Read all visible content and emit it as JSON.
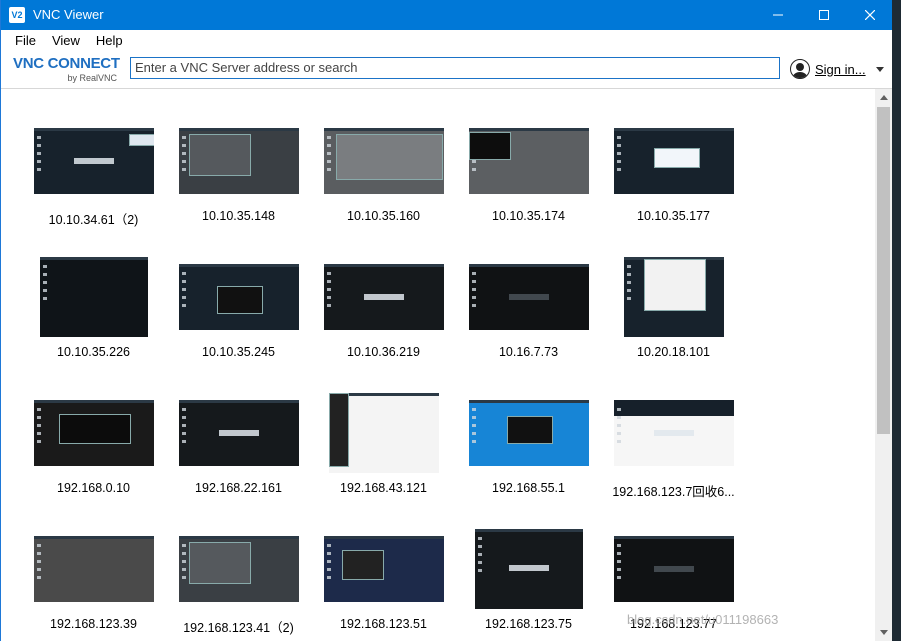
{
  "window": {
    "title": "VNC Viewer",
    "app_icon": "V2"
  },
  "menu": [
    "File",
    "View",
    "Help"
  ],
  "toolbar": {
    "logo_main": "VNC CONNECT",
    "logo_sub": "by RealVNC",
    "search_placeholder": "Enter a VNC Server address or search",
    "signin_label": "Sign in..."
  },
  "servers": [
    {
      "label": "10.10.34.61（2)",
      "style": "yunsnee-dialog"
    },
    {
      "label": "10.10.35.148",
      "style": "grey-window"
    },
    {
      "label": "10.10.35.160",
      "style": "grey-desktop"
    },
    {
      "label": "10.10.35.174",
      "style": "grey-black"
    },
    {
      "label": "10.10.35.177",
      "style": "dark-dialog"
    },
    {
      "label": "10.10.35.226",
      "style": "dark-icons"
    },
    {
      "label": "10.10.35.245",
      "style": "terminal-window"
    },
    {
      "label": "10.10.36.219",
      "style": "yunsnee"
    },
    {
      "label": "10.16.7.73",
      "style": "dark-plain"
    },
    {
      "label": "10.20.18.101",
      "style": "table-window"
    },
    {
      "label": "192.168.0.10",
      "style": "dark-loading"
    },
    {
      "label": "192.168.22.161",
      "style": "yunsnee"
    },
    {
      "label": "192.168.43.121",
      "style": "editor"
    },
    {
      "label": "192.168.55.1",
      "style": "blue-desktop"
    },
    {
      "label": "192.168.123.7回收6...",
      "style": "white-yunsnee"
    },
    {
      "label": "192.168.123.39",
      "style": "grey-temple"
    },
    {
      "label": "192.168.123.41（2)",
      "style": "grey-window"
    },
    {
      "label": "192.168.123.51",
      "style": "blue-windows"
    },
    {
      "label": "192.168.123.75",
      "style": "yunsnee"
    },
    {
      "label": "192.168.123.77",
      "style": "dark-plain"
    }
  ],
  "watermark": "blog.csdn.net/u011198663"
}
